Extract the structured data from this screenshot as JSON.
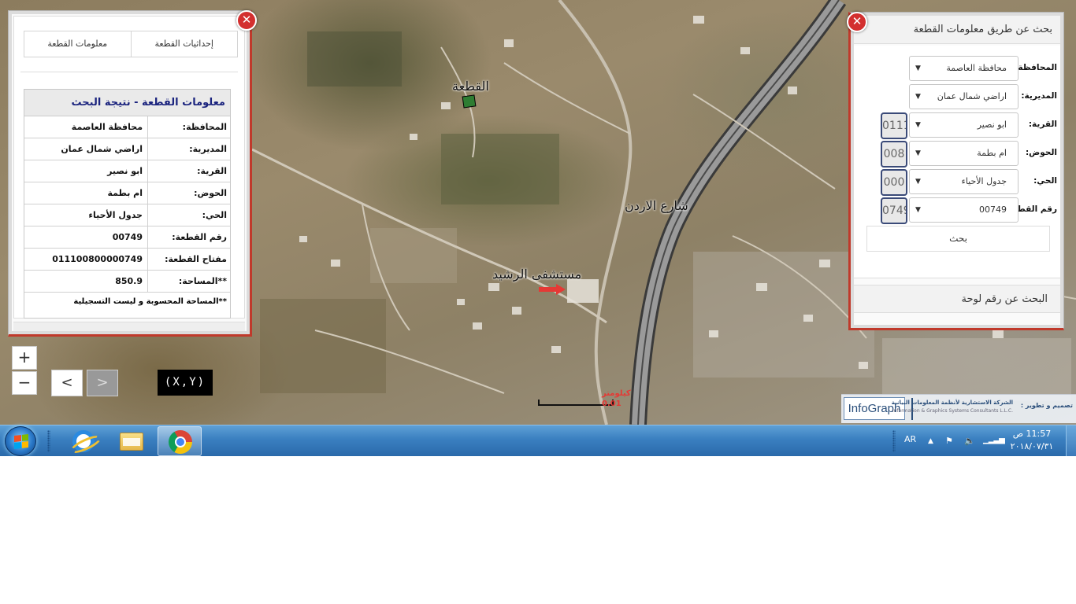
{
  "map": {
    "labels": {
      "parcel": "القطعة",
      "street": "شارع الاردن",
      "hospital": "مستشفى الرشيد"
    },
    "scale": {
      "label_top": "كيلومتر",
      "label_bottom": "0.01"
    },
    "controls": {
      "zoom_in": "+",
      "zoom_out": "−",
      "next": ">",
      "prev": ">",
      "xy": "(X,Y)"
    },
    "credits": {
      "logo": "InfoGraph",
      "company_ar": "الشركة الاستشارية لأنظمة المعلومات البيانية",
      "company_en": "Information & Graphics Systems Consultants L.L.C.",
      "design_label": "تصميم و تطوير :"
    }
  },
  "left_panel": {
    "tabs": [
      "معلومات القطعة",
      "إحداثيات القطعة"
    ],
    "title": "معلومات القطعة - نتيجة البحث",
    "rows": [
      {
        "key": "المحافظة:",
        "value": "محافظة العاصمة"
      },
      {
        "key": "المديرية:",
        "value": "اراضي شمال عمان"
      },
      {
        "key": "القرية:",
        "value": "ابو نصير"
      },
      {
        "key": "الحوض:",
        "value": "ام بطمة"
      },
      {
        "key": "الحي:",
        "value": "جدول الأحياء"
      },
      {
        "key": "رقم القطعة:",
        "value": "00749"
      },
      {
        "key": "مفتاح القطعة:",
        "value": "011100800000749"
      },
      {
        "key": "**المساحة:",
        "value": "850.9"
      }
    ],
    "note": "**المساحة المحسوبة و ليست التسجيلية"
  },
  "right_panel": {
    "title": "بحث عن طريق معلومات القطعة",
    "fields": [
      {
        "label": "المحافظة:",
        "value": "محافظة العاصمة",
        "code": ""
      },
      {
        "label": "المديرية:",
        "value": "اراضي شمال عمان",
        "code": ""
      },
      {
        "label": "القرية:",
        "value": "ابو نصير",
        "code": "0111"
      },
      {
        "label": "الحوض:",
        "value": "ام بطمة",
        "code": "008"
      },
      {
        "label": "الحي:",
        "value": "جدول الأحياء",
        "code": "000"
      },
      {
        "label": "رقم القطعة:",
        "value": "00749",
        "code": "0749"
      }
    ],
    "search_button": "بحث",
    "plate_search": "البحث عن رقم لوحة"
  },
  "taskbar": {
    "language": "AR",
    "time": "11:57 ص",
    "date": "٢٠١٨/٠٧/٣١"
  },
  "colors": {
    "close_red": "#d32f2f",
    "panel_accent": "#c0392b",
    "title_blue": "#1a237e",
    "taskbar": "#3a7fc0"
  },
  "icons": [
    "close-icon",
    "windows-start-icon",
    "internet-explorer-icon",
    "file-explorer-icon",
    "chrome-icon",
    "tray-up-arrow-icon",
    "action-center-flag-icon",
    "speaker-icon",
    "network-signal-icon"
  ]
}
